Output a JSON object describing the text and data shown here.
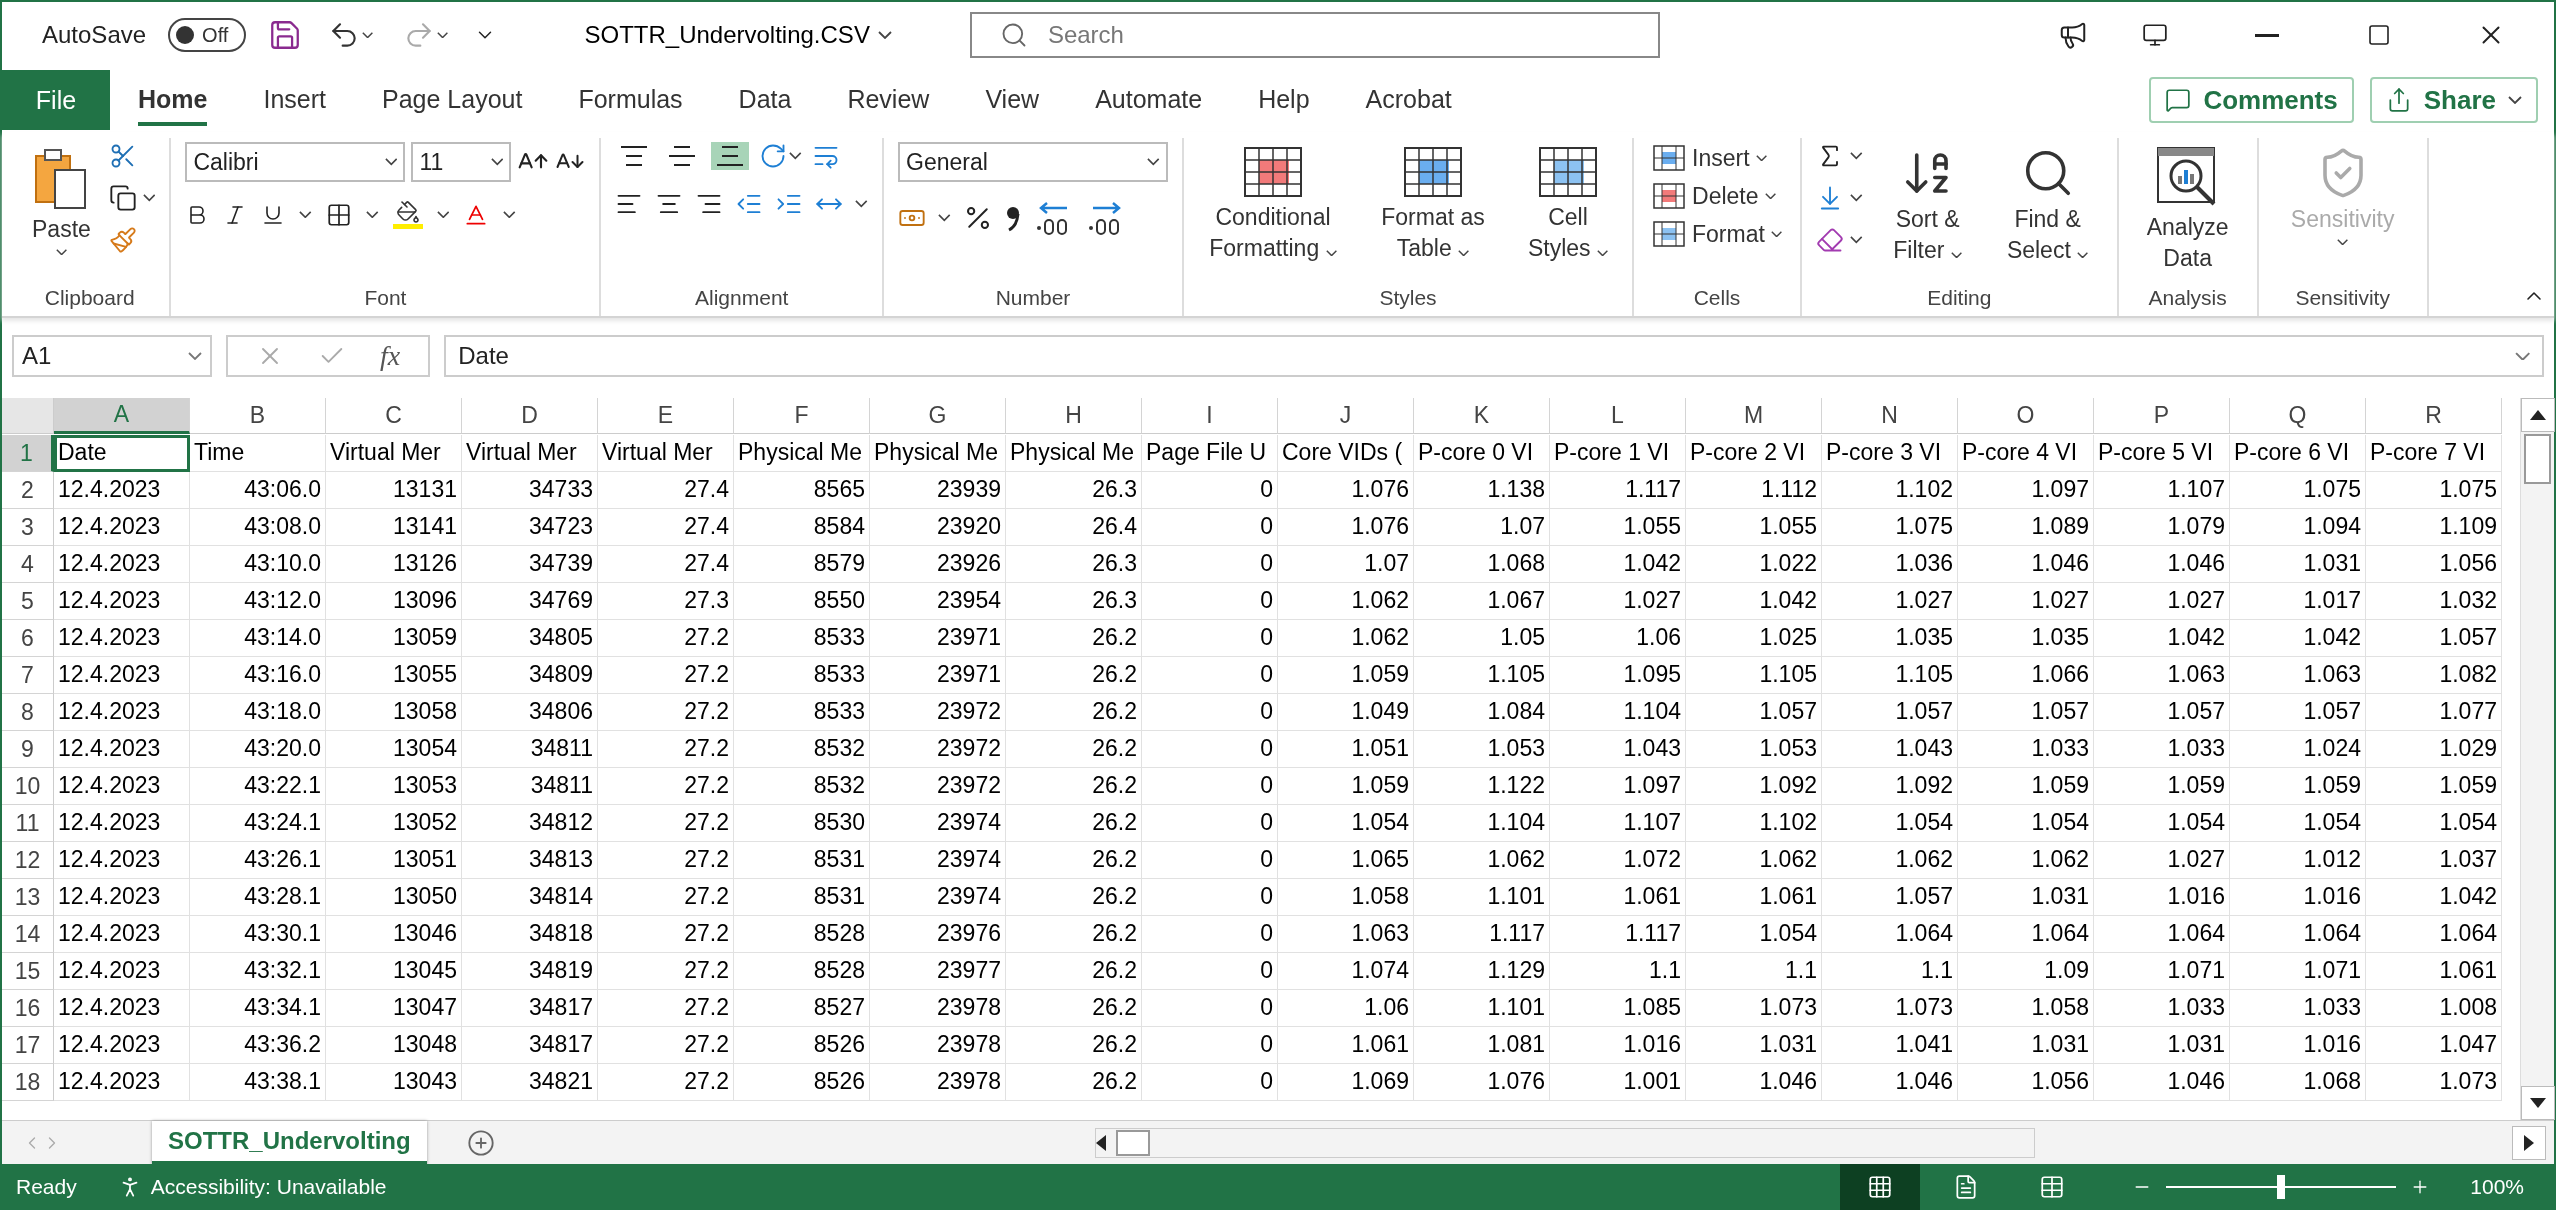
{
  "titlebar": {
    "autosave_label": "AutoSave",
    "autosave_toggle": {
      "label": "Off",
      "on": false
    },
    "filename": "SOTTR_Undervolting.CSV",
    "search": {
      "placeholder": "Search"
    }
  },
  "ribbon_tabs": [
    {
      "label": "File",
      "kind": "file",
      "selected": false
    },
    {
      "label": "Home",
      "kind": "tab",
      "selected": true
    },
    {
      "label": "Insert",
      "kind": "tab",
      "selected": false
    },
    {
      "label": "Page Layout",
      "kind": "tab",
      "selected": false
    },
    {
      "label": "Formulas",
      "kind": "tab",
      "selected": false
    },
    {
      "label": "Data",
      "kind": "tab",
      "selected": false
    },
    {
      "label": "Review",
      "kind": "tab",
      "selected": false
    },
    {
      "label": "View",
      "kind": "tab",
      "selected": false
    },
    {
      "label": "Automate",
      "kind": "tab",
      "selected": false
    },
    {
      "label": "Help",
      "kind": "tab",
      "selected": false
    },
    {
      "label": "Acrobat",
      "kind": "tab",
      "selected": false
    }
  ],
  "ribbon_actions": {
    "comments": "Comments",
    "share": "Share"
  },
  "ribbon": {
    "clipboard": {
      "label": "Clipboard",
      "paste": "Paste"
    },
    "font": {
      "label": "Font",
      "font_name": "Calibri",
      "font_size": "11"
    },
    "alignment": {
      "label": "Alignment",
      "vertical_align": [
        {
          "selected": false
        },
        {
          "selected": false
        },
        {
          "selected": true
        }
      ]
    },
    "number": {
      "label": "Number",
      "format": "General"
    },
    "styles": {
      "label": "Styles",
      "buttons": [
        "Conditional Formatting",
        "Format as Table",
        "Cell Styles"
      ]
    },
    "cells": {
      "label": "Cells",
      "buttons": [
        "Insert",
        "Delete",
        "Format"
      ]
    },
    "editing": {
      "label": "Editing",
      "buttons": [
        "Sort & Filter",
        "Find & Select"
      ]
    },
    "analysis": {
      "label": "Analysis",
      "button": "Analyze Data"
    },
    "sensitivity": {
      "label": "Sensitivity",
      "button": "Sensitivity",
      "disabled": true
    }
  },
  "formula_bar": {
    "name_box": "A1",
    "function_label": "fx",
    "formula": "Date"
  },
  "grid": {
    "columns": [
      {
        "letter": "A",
        "selected": true
      },
      {
        "letter": "B",
        "selected": false
      },
      {
        "letter": "C",
        "selected": false
      },
      {
        "letter": "D",
        "selected": false
      },
      {
        "letter": "E",
        "selected": false
      },
      {
        "letter": "F",
        "selected": false
      },
      {
        "letter": "G",
        "selected": false
      },
      {
        "letter": "H",
        "selected": false
      },
      {
        "letter": "I",
        "selected": false
      },
      {
        "letter": "J",
        "selected": false
      },
      {
        "letter": "K",
        "selected": false
      },
      {
        "letter": "L",
        "selected": false
      },
      {
        "letter": "M",
        "selected": false
      },
      {
        "letter": "N",
        "selected": false
      },
      {
        "letter": "O",
        "selected": false
      },
      {
        "letter": "P",
        "selected": false
      },
      {
        "letter": "Q",
        "selected": false
      },
      {
        "letter": "R",
        "selected": false
      }
    ],
    "rows": [
      {
        "number": "1",
        "kind": "header",
        "selected": true,
        "cells": [
          "Date",
          "Time",
          "Virtual Mer",
          "Virtual Mer",
          "Virtual Mer",
          "Physical Me",
          "Physical Me",
          "Physical Me",
          "Page File U",
          "Core VIDs (",
          "P-core 0 VI",
          "P-core 1 VI",
          "P-core 2 VI",
          "P-core 3 VI",
          "P-core 4 VI",
          "P-core 5 VI",
          "P-core 6 VI",
          "P-core 7 VI"
        ]
      },
      {
        "number": "2",
        "kind": "data",
        "selected": false,
        "cells": [
          "12.4.2023",
          "43:06.0",
          "13131",
          "34733",
          "27.4",
          "8565",
          "23939",
          "26.3",
          "0",
          "1.076",
          "1.138",
          "1.117",
          "1.112",
          "1.102",
          "1.097",
          "1.107",
          "1.075",
          "1.075"
        ]
      },
      {
        "number": "3",
        "kind": "data",
        "selected": false,
        "cells": [
          "12.4.2023",
          "43:08.0",
          "13141",
          "34723",
          "27.4",
          "8584",
          "23920",
          "26.4",
          "0",
          "1.076",
          "1.07",
          "1.055",
          "1.055",
          "1.075",
          "1.089",
          "1.079",
          "1.094",
          "1.109"
        ]
      },
      {
        "number": "4",
        "kind": "data",
        "selected": false,
        "cells": [
          "12.4.2023",
          "43:10.0",
          "13126",
          "34739",
          "27.4",
          "8579",
          "23926",
          "26.3",
          "0",
          "1.07",
          "1.068",
          "1.042",
          "1.022",
          "1.036",
          "1.046",
          "1.046",
          "1.031",
          "1.056"
        ]
      },
      {
        "number": "5",
        "kind": "data",
        "selected": false,
        "cells": [
          "12.4.2023",
          "43:12.0",
          "13096",
          "34769",
          "27.3",
          "8550",
          "23954",
          "26.3",
          "0",
          "1.062",
          "1.067",
          "1.027",
          "1.042",
          "1.027",
          "1.027",
          "1.027",
          "1.017",
          "1.032"
        ]
      },
      {
        "number": "6",
        "kind": "data",
        "selected": false,
        "cells": [
          "12.4.2023",
          "43:14.0",
          "13059",
          "34805",
          "27.2",
          "8533",
          "23971",
          "26.2",
          "0",
          "1.062",
          "1.05",
          "1.06",
          "1.025",
          "1.035",
          "1.035",
          "1.042",
          "1.042",
          "1.057"
        ]
      },
      {
        "number": "7",
        "kind": "data",
        "selected": false,
        "cells": [
          "12.4.2023",
          "43:16.0",
          "13055",
          "34809",
          "27.2",
          "8533",
          "23971",
          "26.2",
          "0",
          "1.059",
          "1.105",
          "1.095",
          "1.105",
          "1.105",
          "1.066",
          "1.063",
          "1.063",
          "1.082"
        ]
      },
      {
        "number": "8",
        "kind": "data",
        "selected": false,
        "cells": [
          "12.4.2023",
          "43:18.0",
          "13058",
          "34806",
          "27.2",
          "8533",
          "23972",
          "26.2",
          "0",
          "1.049",
          "1.084",
          "1.104",
          "1.057",
          "1.057",
          "1.057",
          "1.057",
          "1.057",
          "1.077"
        ]
      },
      {
        "number": "9",
        "kind": "data",
        "selected": false,
        "cells": [
          "12.4.2023",
          "43:20.0",
          "13054",
          "34811",
          "27.2",
          "8532",
          "23972",
          "26.2",
          "0",
          "1.051",
          "1.053",
          "1.043",
          "1.053",
          "1.043",
          "1.033",
          "1.033",
          "1.024",
          "1.029"
        ]
      },
      {
        "number": "10",
        "kind": "data",
        "selected": false,
        "cells": [
          "12.4.2023",
          "43:22.1",
          "13053",
          "34811",
          "27.2",
          "8532",
          "23972",
          "26.2",
          "0",
          "1.059",
          "1.122",
          "1.097",
          "1.092",
          "1.092",
          "1.059",
          "1.059",
          "1.059",
          "1.059"
        ]
      },
      {
        "number": "11",
        "kind": "data",
        "selected": false,
        "cells": [
          "12.4.2023",
          "43:24.1",
          "13052",
          "34812",
          "27.2",
          "8530",
          "23974",
          "26.2",
          "0",
          "1.054",
          "1.104",
          "1.107",
          "1.102",
          "1.054",
          "1.054",
          "1.054",
          "1.054",
          "1.054"
        ]
      },
      {
        "number": "12",
        "kind": "data",
        "selected": false,
        "cells": [
          "12.4.2023",
          "43:26.1",
          "13051",
          "34813",
          "27.2",
          "8531",
          "23974",
          "26.2",
          "0",
          "1.065",
          "1.062",
          "1.072",
          "1.062",
          "1.062",
          "1.062",
          "1.027",
          "1.012",
          "1.037"
        ]
      },
      {
        "number": "13",
        "kind": "data",
        "selected": false,
        "cells": [
          "12.4.2023",
          "43:28.1",
          "13050",
          "34814",
          "27.2",
          "8531",
          "23974",
          "26.2",
          "0",
          "1.058",
          "1.101",
          "1.061",
          "1.061",
          "1.057",
          "1.031",
          "1.016",
          "1.016",
          "1.042"
        ]
      },
      {
        "number": "14",
        "kind": "data",
        "selected": false,
        "cells": [
          "12.4.2023",
          "43:30.1",
          "13046",
          "34818",
          "27.2",
          "8528",
          "23976",
          "26.2",
          "0",
          "1.063",
          "1.117",
          "1.117",
          "1.054",
          "1.064",
          "1.064",
          "1.064",
          "1.064",
          "1.064"
        ]
      },
      {
        "number": "15",
        "kind": "data",
        "selected": false,
        "cells": [
          "12.4.2023",
          "43:32.1",
          "13045",
          "34819",
          "27.2",
          "8528",
          "23977",
          "26.2",
          "0",
          "1.074",
          "1.129",
          "1.1",
          "1.1",
          "1.1",
          "1.09",
          "1.071",
          "1.071",
          "1.061"
        ]
      },
      {
        "number": "16",
        "kind": "data",
        "selected": false,
        "cells": [
          "12.4.2023",
          "43:34.1",
          "13047",
          "34817",
          "27.2",
          "8527",
          "23978",
          "26.2",
          "0",
          "1.06",
          "1.101",
          "1.085",
          "1.073",
          "1.073",
          "1.058",
          "1.033",
          "1.033",
          "1.008"
        ]
      },
      {
        "number": "17",
        "kind": "data",
        "selected": false,
        "cells": [
          "12.4.2023",
          "43:36.2",
          "13048",
          "34817",
          "27.2",
          "8526",
          "23978",
          "26.2",
          "0",
          "1.061",
          "1.081",
          "1.016",
          "1.031",
          "1.041",
          "1.031",
          "1.031",
          "1.016",
          "1.047"
        ]
      },
      {
        "number": "18",
        "kind": "data",
        "selected": false,
        "cells": [
          "12.4.2023",
          "43:38.1",
          "13043",
          "34821",
          "27.2",
          "8526",
          "23978",
          "26.2",
          "0",
          "1.069",
          "1.076",
          "1.001",
          "1.046",
          "1.046",
          "1.056",
          "1.046",
          "1.068",
          "1.073"
        ]
      }
    ]
  },
  "sheet_tabs": [
    {
      "label": "SOTTR_Undervolting",
      "selected": true
    }
  ],
  "status_bar": {
    "status": "Ready",
    "accessibility": "Accessibility: Unavailable",
    "views": [
      {
        "kind": "normal",
        "selected": true
      },
      {
        "kind": "page-layout",
        "selected": false
      },
      {
        "kind": "page-break",
        "selected": false
      }
    ],
    "zoom": {
      "level": 0.5
    },
    "zoom_label": "100%"
  }
}
